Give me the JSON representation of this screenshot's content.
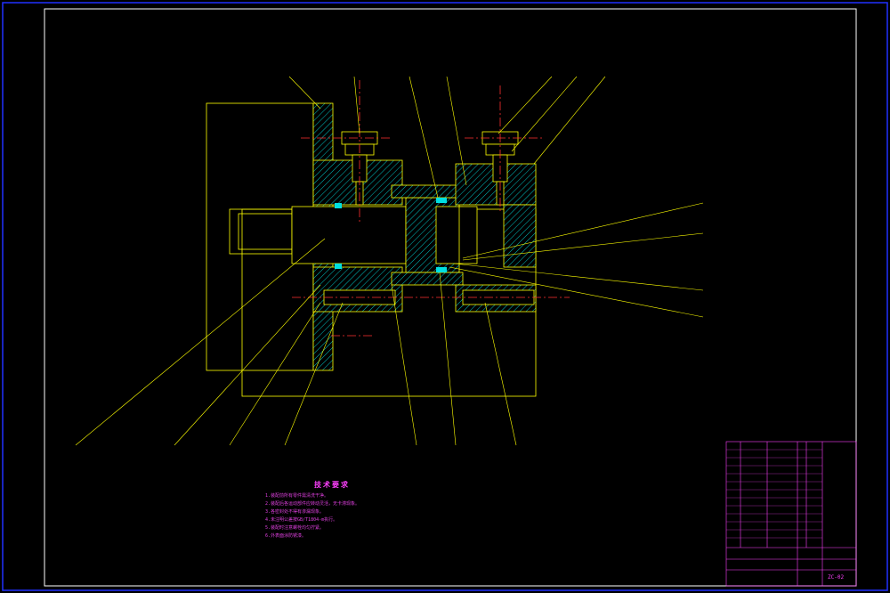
{
  "notes": {
    "title": "技术要求",
    "lines": [
      "1.装配前所有零件需清洗干净。",
      "2.装配后各运动部件应转动灵活，无卡滞现象。",
      "3.各密封处不得有渗漏现象。",
      "4.未注明公差按GB/T1804-m执行。",
      "5.装配时注意螺栓均匀拧紧。",
      "6.外表面涂防锈漆。"
    ]
  },
  "drawing_number": "ZC-02",
  "colors": {
    "frame": "#ffffff",
    "outline": "#ffff00",
    "hatch": "#00c0c0",
    "centerline": "#ff0000",
    "table": "#ff40ff",
    "leader": "#ffff00"
  }
}
